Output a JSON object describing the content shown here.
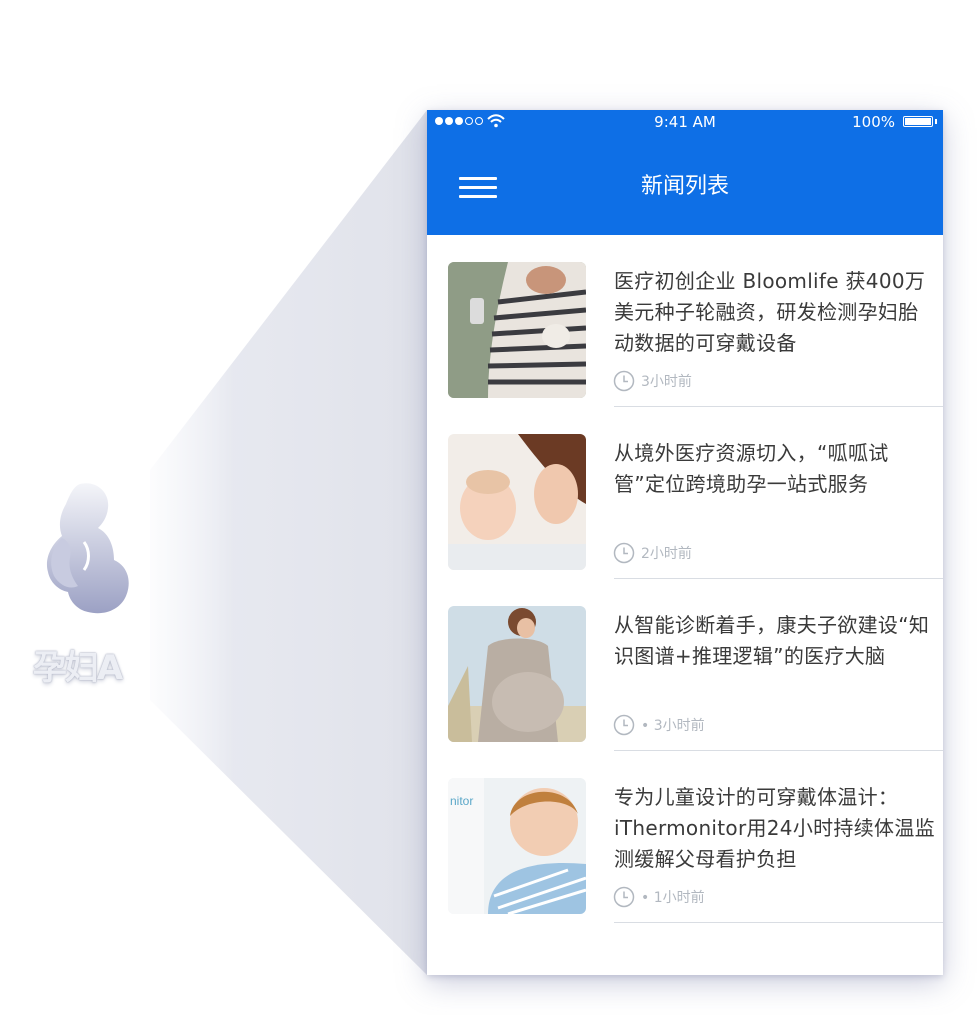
{
  "persona": {
    "label": "孕妇A",
    "icon": "pregnant-woman-icon"
  },
  "status_bar": {
    "time": "9:41 AM",
    "battery_percent": "100%",
    "battery_level": 1.0,
    "signal_bars_filled": 3,
    "signal_bars_total": 5
  },
  "header": {
    "title": "新闻列表",
    "background_color": "#0e6fe6",
    "menu_icon": "hamburger-menu-icon"
  },
  "news": [
    {
      "title": "医疗初创企业 Bloomlife 获400万美元种子轮融资，研发检测孕妇胎动数据的可穿戴设备",
      "time": "3小时前",
      "thumbnail": "pregnant-woman-with-phone-image"
    },
    {
      "title": "从境外医疗资源切入，“呱呱试管”定位跨境助孕一站式服务",
      "time": "2小时前",
      "thumbnail": "mother-and-baby-image"
    },
    {
      "title": "从智能诊断着手，康夫子欲建设“知识图谱+推理逻辑”的医疗大脑",
      "time": "• 3小时前",
      "thumbnail": "pregnant-woman-outdoors-image"
    },
    {
      "title": "专为儿童设计的可穿戴体温计：iThermonitor用24小时持续体温监测缓解父母看护负担",
      "time": "• 1小时前",
      "thumbnail": "sleeping-child-image",
      "thumbnail_caption": "nitor"
    }
  ],
  "colors": {
    "accent": "#0e6fe6",
    "title_text": "#3a3a3a",
    "meta_text": "#b2b8c0",
    "divider": "#d9dde3"
  }
}
